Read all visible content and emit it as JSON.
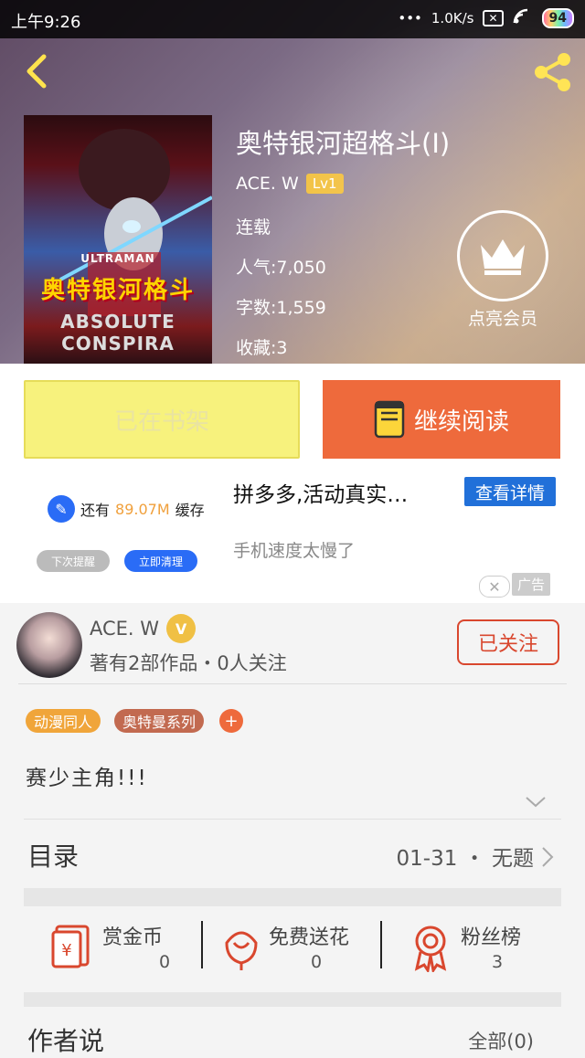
{
  "status_bar": {
    "time": "上午9:26",
    "speed": "1.0K/s",
    "battery": "94"
  },
  "book": {
    "title": "奥特银河超格斗(I)",
    "author": "ACE. W",
    "author_level": "Lv1",
    "status": "连载",
    "popularity": "人气:7,050",
    "word_count": "字数:1,559",
    "favorites": "收藏:3",
    "cover": {
      "brand": "ULTRAMAN",
      "title": "奥特银河格斗",
      "subtitle": "ABSOLUTE CONSPIRA"
    }
  },
  "vip": {
    "label": "点亮会员"
  },
  "actions": {
    "shelf_label": "已在书架",
    "read_label": "继续阅读"
  },
  "ad": {
    "cache_prefix": "还有",
    "cache_amount": "89.07M",
    "cache_suffix": "缓存",
    "remind_later": "下次提醒",
    "clean_now": "立即清理",
    "title": "拼多多,活动真实…",
    "details_button": "查看详情",
    "description": "手机速度太慢了",
    "tag": "广告"
  },
  "author_card": {
    "name": "ACE. W",
    "badge": "V",
    "stats": "著有2部作品・0人关注",
    "follow_label": "已关注"
  },
  "tags": [
    "动漫同人",
    "奥特曼系列"
  ],
  "tag_add": "+",
  "intro": "赛少主角!!!",
  "catalog": {
    "label": "目录",
    "latest": "01-31 ・ 无题"
  },
  "rewards": [
    {
      "label": "赏金币",
      "value": "0"
    },
    {
      "label": "免费送花",
      "value": "0"
    },
    {
      "label": "粉丝榜",
      "value": "3"
    }
  ],
  "author_says": {
    "label": "作者说",
    "all": "全部(0)"
  },
  "colors": {
    "accent": "#ee6a3c",
    "shelf": "#f7f27d",
    "follow": "#d9472e",
    "tag_orange": "#f0a53a",
    "tag_brown": "#c26a50"
  }
}
